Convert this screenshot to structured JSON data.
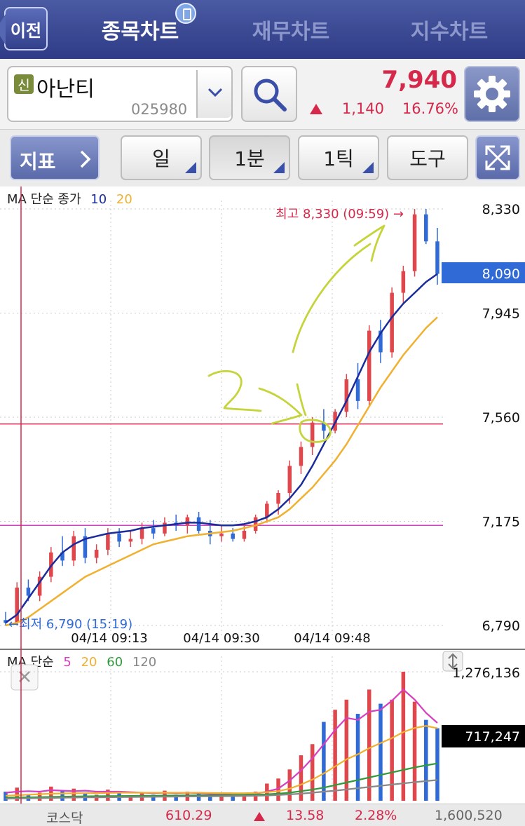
{
  "nav": {
    "back_label": "이전",
    "tabs": [
      "종목차트",
      "재무차트",
      "지수차트"
    ],
    "active_tab": 0
  },
  "stock": {
    "market_tag": "신",
    "name": "아난티",
    "code": "025980",
    "price": "7,940",
    "change": "1,140",
    "change_pct": "16.76%",
    "direction": "up"
  },
  "toolbar": {
    "indicator_label": "지표",
    "period_day": "일",
    "period_min": "1분",
    "tick": "1틱",
    "tools": "도구"
  },
  "colors": {
    "up": "#e0474c",
    "down": "#2f6ad6",
    "ma10": "#1a2c9c",
    "ma20": "#f0b030",
    "vol_ma5": "#d63fc0",
    "vol_ma20": "#f0b030",
    "vol_ma60": "#2f9a3a",
    "vol_ma120": "#888888",
    "accent": "#d6284b"
  },
  "price_chart": {
    "legend": {
      "label": "MA 단순 종가",
      "ma1": "10",
      "ma2": "20"
    },
    "y_labels": [
      "8,330",
      "7,945",
      "7,560",
      "7,175",
      "6,790"
    ],
    "current_tag": "8,090",
    "x_labels": [
      "04/14 09:13",
      "04/14 09:30",
      "04/14 09:48"
    ],
    "high_note": "최고 8,330 (09:59) →",
    "low_note": "←최저 6,790 (15:19)"
  },
  "volume_chart": {
    "legend": {
      "label": "MA 단순",
      "ma1": "5",
      "ma2": "20",
      "ma3": "60",
      "ma4": "120"
    },
    "max_label": "1,276,136",
    "current_tag": "717,247"
  },
  "chart_data": [
    {
      "type": "candlestick",
      "title": "MA 단순 종가",
      "ylim": [
        6790,
        8330
      ],
      "series": [
        {
          "name": "10",
          "values": [
            6800,
            6830,
            6890,
            6950,
            7010,
            7060,
            7090,
            7110,
            7120,
            7130,
            7135,
            7140,
            7150,
            7155,
            7160,
            7165,
            7170,
            7170,
            7165,
            7160,
            7160,
            7165,
            7175,
            7190,
            7220,
            7260,
            7310,
            7380,
            7460,
            7540,
            7620,
            7710,
            7800,
            7870,
            7930,
            7980,
            8020,
            8060,
            8090
          ]
        },
        {
          "name": "20",
          "values": [
            6790,
            6800,
            6820,
            6850,
            6880,
            6910,
            6940,
            6970,
            6990,
            7010,
            7030,
            7050,
            7070,
            7090,
            7100,
            7110,
            7120,
            7125,
            7130,
            7135,
            7140,
            7150,
            7160,
            7175,
            7190,
            7220,
            7260,
            7300,
            7350,
            7400,
            7460,
            7530,
            7600,
            7670,
            7730,
            7790,
            7840,
            7890,
            7930
          ]
        }
      ],
      "candles": [
        {
          "o": 6810,
          "h": 6840,
          "l": 6790,
          "c": 6800
        },
        {
          "o": 6800,
          "h": 6950,
          "l": 6790,
          "c": 6930
        },
        {
          "o": 6930,
          "h": 6960,
          "l": 6880,
          "c": 6900
        },
        {
          "o": 6900,
          "h": 6990,
          "l": 6880,
          "c": 6970
        },
        {
          "o": 6970,
          "h": 7080,
          "l": 6950,
          "c": 7060
        },
        {
          "o": 7060,
          "h": 7120,
          "l": 7010,
          "c": 7030
        },
        {
          "o": 7030,
          "h": 7140,
          "l": 7010,
          "c": 7120
        },
        {
          "o": 7120,
          "h": 7150,
          "l": 7020,
          "c": 7040
        },
        {
          "o": 7040,
          "h": 7090,
          "l": 7020,
          "c": 7070
        },
        {
          "o": 7070,
          "h": 7150,
          "l": 7050,
          "c": 7130
        },
        {
          "o": 7130,
          "h": 7150,
          "l": 7080,
          "c": 7100
        },
        {
          "o": 7100,
          "h": 7140,
          "l": 7080,
          "c": 7110
        },
        {
          "o": 7110,
          "h": 7170,
          "l": 7090,
          "c": 7150
        },
        {
          "o": 7150,
          "h": 7180,
          "l": 7110,
          "c": 7130
        },
        {
          "o": 7130,
          "h": 7190,
          "l": 7120,
          "c": 7170
        },
        {
          "o": 7170,
          "h": 7200,
          "l": 7140,
          "c": 7160
        },
        {
          "o": 7160,
          "h": 7200,
          "l": 7130,
          "c": 7190
        },
        {
          "o": 7190,
          "h": 7210,
          "l": 7130,
          "c": 7140
        },
        {
          "o": 7140,
          "h": 7180,
          "l": 7090,
          "c": 7120
        },
        {
          "o": 7120,
          "h": 7160,
          "l": 7100,
          "c": 7130
        },
        {
          "o": 7130,
          "h": 7150,
          "l": 7100,
          "c": 7110
        },
        {
          "o": 7110,
          "h": 7160,
          "l": 7100,
          "c": 7140
        },
        {
          "o": 7140,
          "h": 7200,
          "l": 7130,
          "c": 7190
        },
        {
          "o": 7190,
          "h": 7250,
          "l": 7170,
          "c": 7240
        },
        {
          "o": 7240,
          "h": 7290,
          "l": 7200,
          "c": 7280
        },
        {
          "o": 7280,
          "h": 7400,
          "l": 7240,
          "c": 7380
        },
        {
          "o": 7380,
          "h": 7470,
          "l": 7350,
          "c": 7450
        },
        {
          "o": 7450,
          "h": 7560,
          "l": 7420,
          "c": 7540
        },
        {
          "o": 7540,
          "h": 7590,
          "l": 7480,
          "c": 7510
        },
        {
          "o": 7510,
          "h": 7590,
          "l": 7500,
          "c": 7580
        },
        {
          "o": 7580,
          "h": 7720,
          "l": 7560,
          "c": 7700
        },
        {
          "o": 7700,
          "h": 7760,
          "l": 7590,
          "c": 7620
        },
        {
          "o": 7620,
          "h": 7900,
          "l": 7600,
          "c": 7880
        },
        {
          "o": 7880,
          "h": 7920,
          "l": 7760,
          "c": 7800
        },
        {
          "o": 7800,
          "h": 8040,
          "l": 7780,
          "c": 8020
        },
        {
          "o": 8020,
          "h": 8120,
          "l": 7980,
          "c": 8100
        },
        {
          "o": 8100,
          "h": 8330,
          "l": 8080,
          "c": 8310
        },
        {
          "o": 8310,
          "h": 8330,
          "l": 8200,
          "c": 8210
        },
        {
          "o": 8210,
          "h": 8260,
          "l": 8050,
          "c": 8090
        }
      ]
    },
    {
      "type": "bar",
      "title": "MA 단순",
      "ylim": [
        0,
        1276136
      ],
      "values": [
        90000,
        130000,
        60000,
        80000,
        140000,
        100000,
        120000,
        70000,
        60000,
        110000,
        90000,
        50000,
        80000,
        60000,
        100000,
        60000,
        90000,
        70000,
        50000,
        60000,
        50000,
        60000,
        90000,
        170000,
        220000,
        310000,
        450000,
        560000,
        780000,
        900000,
        1000000,
        860000,
        1100000,
        960000,
        1000000,
        1276136,
        980000,
        800000,
        717247
      ],
      "series": [
        {
          "name": "5",
          "values": [
            80000,
            90000,
            95000,
            90000,
            105000,
            100000,
            95000,
            100000,
            90000,
            90000,
            90000,
            85000,
            80000,
            75000,
            80000,
            75000,
            80000,
            75000,
            70000,
            70000,
            60000,
            60000,
            70000,
            90000,
            120000,
            200000,
            300000,
            420000,
            560000,
            700000,
            820000,
            800000,
            880000,
            900000,
            990000,
            1100000,
            1000000,
            870000,
            770000
          ]
        },
        {
          "name": "20",
          "values": [
            50000,
            55000,
            60000,
            65000,
            70000,
            72000,
            74000,
            75000,
            76000,
            78000,
            80000,
            80000,
            80000,
            80000,
            80000,
            80000,
            80000,
            80000,
            78000,
            76000,
            75000,
            75000,
            78000,
            85000,
            95000,
            120000,
            160000,
            210000,
            270000,
            340000,
            410000,
            460000,
            520000,
            570000,
            620000,
            680000,
            720000,
            740000,
            717247
          ]
        },
        {
          "name": "60",
          "values": [
            30000,
            32000,
            34000,
            36000,
            38000,
            40000,
            42000,
            44000,
            45000,
            46000,
            47000,
            48000,
            49000,
            50000,
            51000,
            52000,
            53000,
            54000,
            55000,
            56000,
            57000,
            58000,
            60000,
            64000,
            70000,
            80000,
            95000,
            110000,
            130000,
            155000,
            180000,
            205000,
            230000,
            255000,
            280000,
            305000,
            330000,
            350000,
            370000
          ]
        },
        {
          "name": "120",
          "values": [
            20000,
            22000,
            24000,
            26000,
            28000,
            30000,
            32000,
            33000,
            34000,
            35000,
            36000,
            37000,
            38000,
            39000,
            40000,
            41000,
            42000,
            43000,
            44000,
            45000,
            46000,
            47000,
            49000,
            52000,
            57000,
            63000,
            70000,
            80000,
            90000,
            100000,
            112000,
            124000,
            136000,
            148000,
            160000,
            172000,
            184000,
            195000,
            205000
          ]
        }
      ]
    }
  ],
  "index_bar": {
    "name": "코스닥",
    "value": "610.29",
    "change": "13.58",
    "pct": "2.28%",
    "volume": "1,600,520"
  }
}
